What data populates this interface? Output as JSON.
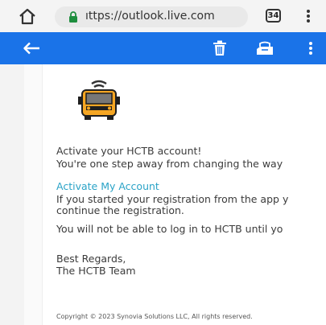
{
  "browser": {
    "url": "ıttps://outlook.live.com",
    "tab_count": "34",
    "icons": {
      "home": "home-icon",
      "lock": "lock-icon",
      "menu": "more-vertical-icon"
    }
  },
  "toolbar": {
    "icons": {
      "back": "back-arrow-icon",
      "delete": "trash-icon",
      "move": "move-to-folder-icon",
      "more": "more-vertical-icon"
    },
    "color": "#1a73e8"
  },
  "email": {
    "heading_line1": "Activate your HCTB account!",
    "heading_line2": "You're one step away from changing the way",
    "activate_link": "Activate My Account",
    "para1_line1": "If you started your registration from the app y",
    "para1_line2": "continue the registration.",
    "para2": "You will not be able to log in to HCTB until yo",
    "closing_line1": "Best Regards,",
    "closing_line2": "The HCTB Team",
    "copyright": "Copyright © 2023 Synovia Solutions LLC, All rights reserved.",
    "link_color": "#2aa3c7"
  }
}
